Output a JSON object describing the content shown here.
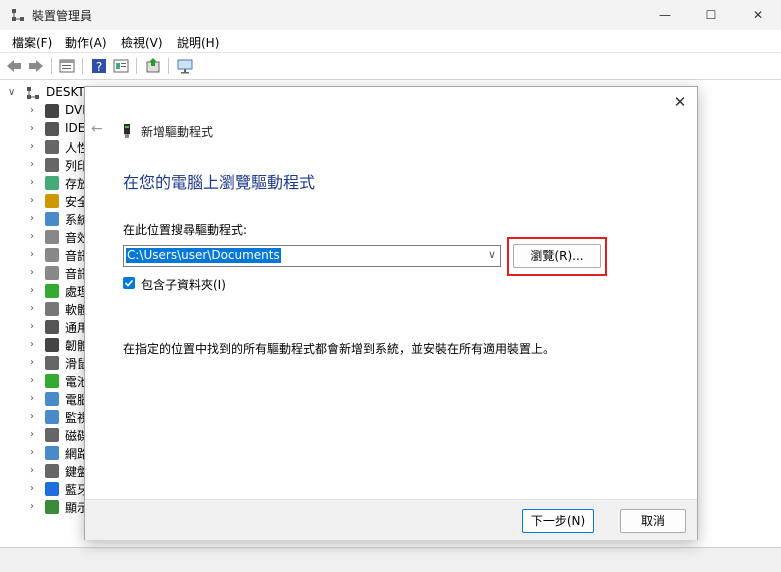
{
  "window": {
    "title": "裝置管理員",
    "minimize": "—",
    "maximize": "☐",
    "close": "✕"
  },
  "menu": [
    "檔案(F)",
    "動作(A)",
    "檢視(V)",
    "說明(H)"
  ],
  "tree": {
    "root": {
      "label": "DESKT"
    },
    "items": [
      {
        "label": "DVI",
        "icon": "dvd-drive-icon",
        "color": "#444"
      },
      {
        "label": "IDE",
        "icon": "ide-controller-icon",
        "color": "#555"
      },
      {
        "label": "人性",
        "icon": "hid-icon",
        "color": "#666"
      },
      {
        "label": "列印",
        "icon": "print-queue-icon",
        "color": "#666"
      },
      {
        "label": "存放",
        "icon": "storage-controller-icon",
        "color": "#4a7"
      },
      {
        "label": "安全",
        "icon": "security-device-icon",
        "color": "#c90"
      },
      {
        "label": "系統",
        "icon": "system-device-icon",
        "color": "#4a8ac8"
      },
      {
        "label": "音效",
        "icon": "audio-icon",
        "color": "#888"
      },
      {
        "label": "音訊",
        "icon": "audio-icon",
        "color": "#888"
      },
      {
        "label": "音訊",
        "icon": "audio-icon",
        "color": "#888"
      },
      {
        "label": "處理",
        "icon": "processor-icon",
        "color": "#3a3"
      },
      {
        "label": "軟體",
        "icon": "software-device-icon",
        "color": "#777"
      },
      {
        "label": "通用",
        "icon": "usb-icon",
        "color": "#555"
      },
      {
        "label": "韌體",
        "icon": "firmware-icon",
        "color": "#444"
      },
      {
        "label": "滑鼠",
        "icon": "mouse-icon",
        "color": "#666"
      },
      {
        "label": "電池",
        "icon": "battery-icon",
        "color": "#3a3"
      },
      {
        "label": "電腦",
        "icon": "computer-icon",
        "color": "#4a8ac8"
      },
      {
        "label": "監視",
        "icon": "monitor-icon",
        "color": "#4a8ac8"
      },
      {
        "label": "磁碟",
        "icon": "disk-drive-icon",
        "color": "#666"
      },
      {
        "label": "網路",
        "icon": "network-adapter-icon",
        "color": "#4a8ac8"
      },
      {
        "label": "鍵盤",
        "icon": "keyboard-icon",
        "color": "#666"
      },
      {
        "label": "藍牙",
        "icon": "bluetooth-icon",
        "color": "#1e6fd9"
      },
      {
        "label": "顯示",
        "icon": "display-adapter-icon",
        "color": "#3a8a3a"
      }
    ]
  },
  "dialog": {
    "close": "✕",
    "back": "←",
    "wizard_title": "新增驅動程式",
    "heading": "在您的電腦上瀏覽驅動程式",
    "search_label": "在此位置搜尋驅動程式:",
    "path_value": "C:\\Users\\user\\Documents",
    "browse_label": "瀏覽(R)...",
    "include_subfolders_label": "包含子資料夾(I)",
    "include_subfolders_checked": true,
    "info": "在指定的位置中找到的所有驅動程式都會新增到系統，並安裝在所有適用裝置上。",
    "next_label": "下一步(N)",
    "cancel_label": "取消"
  },
  "colors": {
    "accent": "#0078d7",
    "highlight_box": "#e02020",
    "heading": "#1e3a8a"
  }
}
